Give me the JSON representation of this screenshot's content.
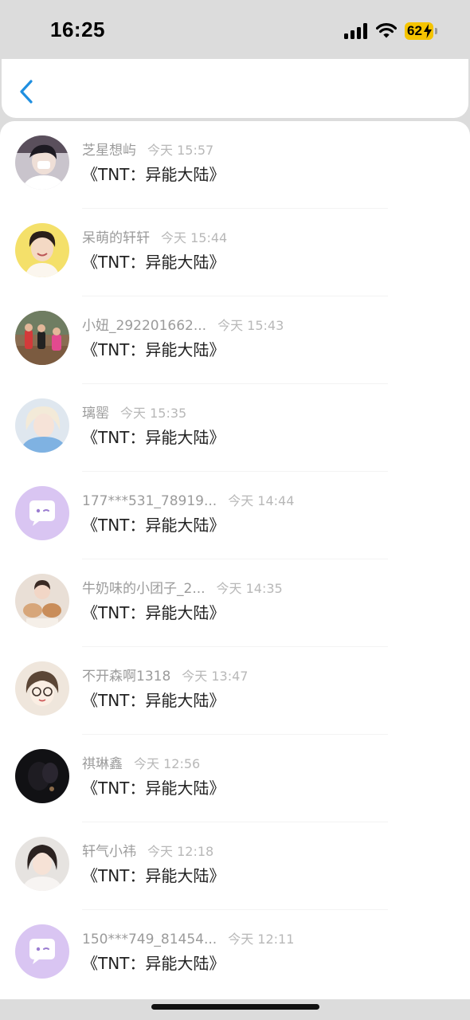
{
  "status_bar": {
    "time": "16:25",
    "battery_level": "62",
    "icons": [
      "signal-icon",
      "wifi-icon",
      "battery-charging-icon"
    ]
  },
  "header": {
    "back_icon": "chevron-left-icon"
  },
  "colors": {
    "accent": "#1f8fe0",
    "name_text": "#9b9b9b",
    "time_text": "#b8b8b8",
    "title_text": "#222222",
    "battery": "#f5c400",
    "default_avatar_bg": "#d9c5f2"
  },
  "messages": [
    {
      "name": "芝星想屿",
      "time": "今天 15:57",
      "title": "《TNT：异能大陆》",
      "avatar": "photo-avatar"
    },
    {
      "name": "呆萌的轩轩",
      "time": "今天 15:44",
      "title": "《TNT：异能大陆》",
      "avatar": "photo-avatar"
    },
    {
      "name": "小妞_292201662...",
      "time": "今天 15:43",
      "title": "《TNT：异能大陆》",
      "avatar": "photo-avatar"
    },
    {
      "name": "璃罂",
      "time": "今天 15:35",
      "title": "《TNT：异能大陆》",
      "avatar": "photo-avatar"
    },
    {
      "name": "177***531_78919...",
      "time": "今天 14:44",
      "title": "《TNT：异能大陆》",
      "avatar": "default-chat-bubble-avatar"
    },
    {
      "name": "牛奶味的小团子_2...",
      "time": "今天 14:35",
      "title": "《TNT：异能大陆》",
      "avatar": "photo-avatar"
    },
    {
      "name": "不开森啊1318",
      "time": "今天 13:47",
      "title": "《TNT：异能大陆》",
      "avatar": "cartoon-avatar"
    },
    {
      "name": "祺琳鑫",
      "time": "今天 12:56",
      "title": "《TNT：异能大陆》",
      "avatar": "photo-avatar"
    },
    {
      "name": "轩气小祎",
      "time": "今天 12:18",
      "title": "《TNT：异能大陆》",
      "avatar": "photo-avatar"
    },
    {
      "name": "150***749_81454...",
      "time": "今天 12:11",
      "title": "《TNT：异能大陆》",
      "avatar": "default-chat-bubble-avatar"
    }
  ]
}
